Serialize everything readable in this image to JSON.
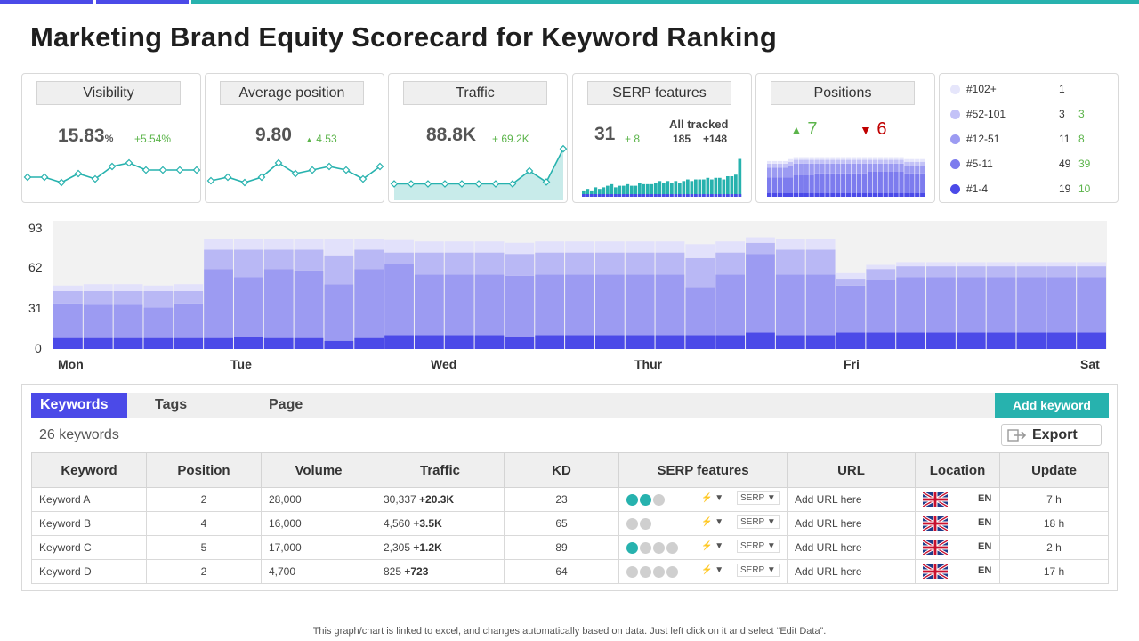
{
  "title": "Marketing Brand Equity Scorecard for Keyword Ranking",
  "colors": {
    "accent_purple": "#4b4ae8",
    "teal": "#27b2ae",
    "light_purple_1": "#e6e6fb",
    "light_purple_2": "#c3c2f7",
    "mid_purple": "#9c9bf2",
    "deep_purple": "#7d7cee",
    "green": "#5bb44a",
    "red": "#c00000"
  },
  "cards": {
    "visibility": {
      "title": "Visibility",
      "value": "15.83",
      "unit": "%",
      "delta": "+5.54%",
      "trend": [
        5,
        5,
        2,
        7,
        4,
        11,
        13,
        9,
        9,
        9,
        9
      ]
    },
    "avg_position": {
      "title": "Average position",
      "value": "9.80",
      "delta": "4.53",
      "trend": [
        3,
        5,
        2,
        5,
        13,
        7,
        9,
        11,
        9,
        4,
        11
      ]
    },
    "traffic": {
      "title": "Traffic",
      "value": "88.8K",
      "delta": "+ 69.2K",
      "trend": [
        7,
        7,
        7,
        7,
        7,
        7,
        7,
        7,
        14,
        8,
        26
      ]
    },
    "serp": {
      "title": "SERP features",
      "value": "31",
      "delta": "+ 8",
      "tracked_label": "All tracked",
      "tracked_value": "185",
      "tracked_delta": "+148",
      "bars": [
        4,
        5,
        4,
        6,
        5,
        6,
        7,
        8,
        6,
        7,
        7,
        8,
        7,
        7,
        9,
        8,
        8,
        8,
        9,
        10,
        9,
        10,
        9,
        10,
        9,
        10,
        11,
        10,
        11,
        11,
        11,
        12,
        11,
        12,
        12,
        11,
        13,
        13,
        14,
        24
      ]
    },
    "positions": {
      "title": "Positions",
      "up": "7",
      "down": "6",
      "bars": [
        [
          2,
          8,
          5,
          2
        ],
        [
          2,
          8,
          5,
          2
        ],
        [
          2,
          8,
          5,
          2
        ],
        [
          2,
          8,
          5,
          2
        ],
        [
          2,
          8,
          6,
          2
        ],
        [
          2,
          9,
          6,
          2
        ],
        [
          2,
          9,
          6,
          2
        ],
        [
          2,
          9,
          6,
          2
        ],
        [
          2,
          9,
          6,
          2
        ],
        [
          2,
          10,
          5,
          2
        ],
        [
          2,
          10,
          5,
          2
        ],
        [
          2,
          10,
          5,
          2
        ],
        [
          2,
          10,
          5,
          2
        ],
        [
          2,
          10,
          5,
          2
        ],
        [
          2,
          10,
          5,
          2
        ],
        [
          2,
          10,
          5,
          2
        ],
        [
          2,
          10,
          5,
          2
        ],
        [
          2,
          10,
          5,
          2
        ],
        [
          2,
          10,
          5,
          2
        ],
        [
          2,
          11,
          4,
          2
        ],
        [
          2,
          11,
          4,
          2
        ],
        [
          2,
          11,
          4,
          2
        ],
        [
          2,
          11,
          4,
          2
        ],
        [
          2,
          11,
          4,
          2
        ],
        [
          2,
          11,
          4,
          2
        ],
        [
          2,
          11,
          4,
          2
        ],
        [
          2,
          10,
          4,
          2
        ],
        [
          2,
          10,
          4,
          2
        ],
        [
          2,
          10,
          4,
          2
        ],
        [
          2,
          10,
          4,
          2
        ]
      ]
    }
  },
  "legend": [
    {
      "label": "#102+",
      "value": "1",
      "delta": "",
      "color": "#e6e6fb"
    },
    {
      "label": "#52-101",
      "value": "3",
      "delta": "3",
      "color": "#c3c2f7"
    },
    {
      "label": "#12-51",
      "value": "11",
      "delta": "8",
      "color": "#9c9bf2"
    },
    {
      "label": "#5-11",
      "value": "49",
      "delta": "39",
      "color": "#7d7cee"
    },
    {
      "label": "#1-4",
      "value": "19",
      "delta": "10",
      "color": "#4b4ae8"
    }
  ],
  "chart_data": {
    "type": "bar",
    "stacked": true,
    "y_ticks": [
      "93",
      "62",
      "31",
      "0"
    ],
    "ylim": [
      0,
      93
    ],
    "x_labels": [
      "Mon",
      "Tue",
      "Wed",
      "Thur",
      "Fri",
      "Sat"
    ],
    "series": [
      {
        "name": "#1-4",
        "values": [
          8,
          8,
          8,
          8,
          8,
          8,
          9,
          8,
          8,
          6,
          8,
          10,
          10,
          10,
          10,
          9,
          10,
          10,
          10,
          10,
          10,
          10,
          10,
          12,
          10,
          10,
          12,
          12,
          12,
          12,
          12,
          12,
          12,
          12,
          12
        ]
      },
      {
        "name": "#5-11",
        "values": [
          25,
          24,
          24,
          22,
          25,
          50,
          43,
          50,
          49,
          41,
          50,
          52,
          44,
          44,
          44,
          44,
          44,
          44,
          44,
          44,
          44,
          35,
          44,
          57,
          44,
          44,
          34,
          38,
          40,
          40,
          40,
          40,
          40,
          40,
          40
        ]
      },
      {
        "name": "#12-51",
        "values": [
          9,
          10,
          10,
          12,
          9,
          14,
          20,
          14,
          15,
          21,
          14,
          8,
          16,
          16,
          16,
          16,
          16,
          16,
          16,
          16,
          16,
          21,
          16,
          8,
          18,
          18,
          5,
          8,
          8,
          8,
          8,
          8,
          8,
          8,
          8
        ]
      },
      {
        "name": "#52-101",
        "values": [
          4,
          5,
          5,
          4,
          5,
          8,
          8,
          8,
          8,
          12,
          8,
          9,
          8,
          8,
          8,
          8,
          8,
          8,
          8,
          8,
          8,
          10,
          8,
          4,
          8,
          8,
          4,
          3,
          3,
          3,
          3,
          3,
          3,
          3,
          3
        ]
      },
      {
        "name": "#102+",
        "values": [
          0,
          0,
          0,
          0,
          0,
          0,
          0,
          0,
          0,
          0,
          0,
          0,
          0,
          0,
          0,
          0,
          0,
          0,
          0,
          0,
          0,
          0,
          0,
          0,
          0,
          0,
          0,
          0,
          0,
          0,
          0,
          0,
          0,
          0,
          0
        ]
      }
    ],
    "grid": false
  },
  "table": {
    "tabs": {
      "keywords": "Keywords",
      "tags": "Tags",
      "page": "Page"
    },
    "add_keyword": "Add keyword",
    "count": "26 keywords",
    "export": "Export",
    "headers": {
      "keyword": "Keyword",
      "position": "Position",
      "volume": "Volume",
      "traffic": "Traffic",
      "kd": "KD",
      "serp": "SERP features",
      "url": "URL",
      "location": "Location",
      "update": "Update"
    },
    "rows": [
      {
        "keyword": "Keyword A",
        "position": "2",
        "volume": "28,000",
        "traffic": "30,337",
        "traffic_delta": "+20.3K",
        "kd": "23",
        "serp_dots": [
          "#27b2ae",
          "#27b2ae",
          "#cfcfcf"
        ],
        "serp_label": "SERP",
        "url": "Add URL here",
        "lang": "EN",
        "update": "7 h"
      },
      {
        "keyword": "Keyword B",
        "position": "4",
        "volume": "16,000",
        "traffic": "4,560",
        "traffic_delta": "+3.5K",
        "kd": "65",
        "serp_dots": [
          "#cfcfcf",
          "#cfcfcf"
        ],
        "serp_label": "SERP",
        "url": "Add URL here",
        "lang": "EN",
        "update": "18 h"
      },
      {
        "keyword": "Keyword C",
        "position": "5",
        "volume": "17,000",
        "traffic": "2,305",
        "traffic_delta": "+1.2K",
        "kd": "89",
        "serp_dots": [
          "#27b2ae",
          "#cfcfcf",
          "#cfcfcf",
          "#cfcfcf"
        ],
        "serp_label": "SERP",
        "url": "Add URL here",
        "lang": "EN",
        "update": "2 h"
      },
      {
        "keyword": "Keyword D",
        "position": "2",
        "volume": "4,700",
        "traffic": "825",
        "traffic_delta": "+723",
        "kd": "64",
        "serp_dots": [
          "#cfcfcf",
          "#cfcfcf",
          "#cfcfcf",
          "#cfcfcf"
        ],
        "serp_label": "SERP",
        "url": "Add URL here",
        "lang": "EN",
        "update": "17 h"
      }
    ]
  },
  "footnote": "This graph/chart is linked to excel,  and changes automatically based on data. Just left click on it and select “Edit Data”."
}
